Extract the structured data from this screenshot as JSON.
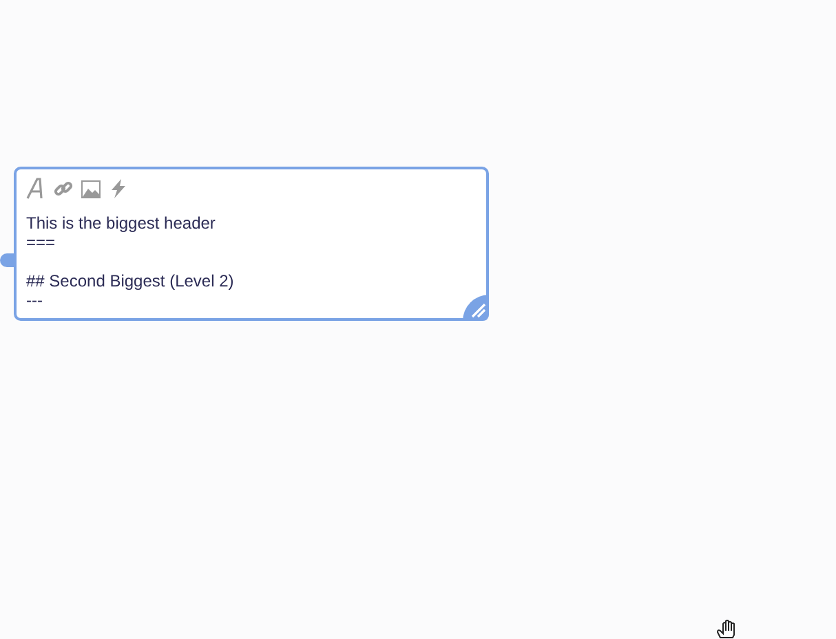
{
  "editor": {
    "blocks": [
      {
        "lines": [
          "This is the biggest header",
          "==="
        ]
      },
      {
        "lines": [
          "## Second Biggest (Level 2)",
          "---"
        ]
      }
    ]
  }
}
